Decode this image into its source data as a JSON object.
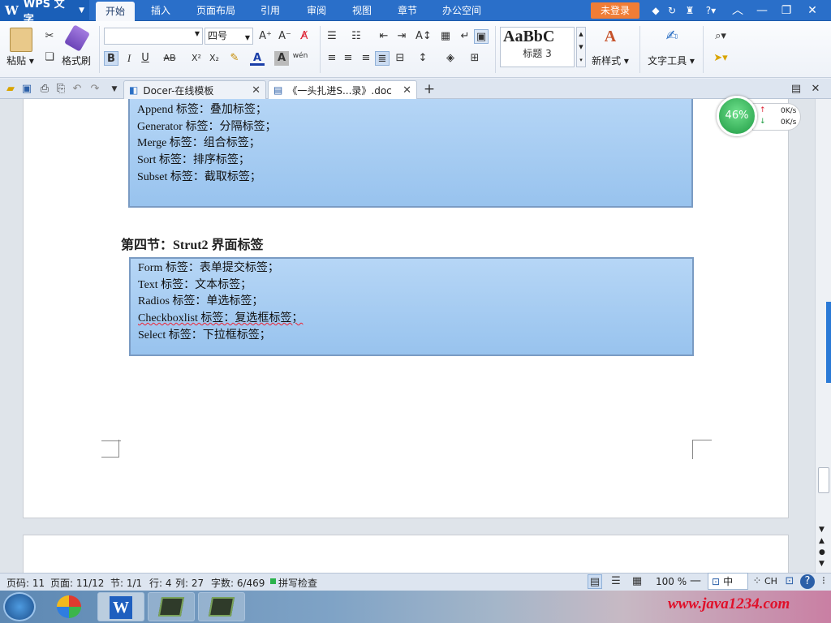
{
  "app": {
    "name": "WPS 文字",
    "logo_letter": "W"
  },
  "menu_tabs": [
    "开始",
    "插入",
    "页面布局",
    "引用",
    "审阅",
    "视图",
    "章节",
    "办公空间"
  ],
  "active_menu_tab": "开始",
  "login_button": "未登录",
  "ribbon": {
    "paste_label": "粘贴",
    "format_painter_label": "格式刷",
    "font_name_value": "",
    "font_size_value": "四号",
    "style_preview": "AaBbC",
    "style_name": "标题 3",
    "new_style_label": "新样式",
    "text_tools_label": "文字工具",
    "buttons": {
      "bold": "B",
      "italic": "I",
      "underline": "U",
      "strike": "AB",
      "superscript": "X²",
      "subscript": "X₂",
      "font_color": "A",
      "char_shade": "A",
      "phonetic": "wén"
    }
  },
  "doc_tabs": [
    {
      "label": "Docer-在线模板",
      "active": false
    },
    {
      "label": "《一头扎进S...录》.doc",
      "active": true
    }
  ],
  "document": {
    "box1_lines": [
      "Append 标签：叠加标签；",
      "Generator 标签：分隔标签；",
      "Merge 标签：组合标签；",
      "Sort 标签：排序标签；",
      "Subset 标签：截取标签；"
    ],
    "section_heading": "第四节：Strut2 界面标签",
    "box2_lines": [
      "Form 标签：表单提交标签；",
      "Text 标签：文本标签；",
      "Radios 标签：单选标签；",
      "Checkboxlist 标签：复选框标签；",
      "Select 标签：下拉框标签；"
    ]
  },
  "net_monitor": {
    "percent": "46%",
    "up_speed": "0K/s",
    "down_speed": "0K/s"
  },
  "status_bar": {
    "page_code": "页码: 11",
    "page": "页面: 11/12",
    "section": "节: 1/1",
    "row": "行: 4",
    "col": "列: 27",
    "word_count": "字数: 6/469",
    "spell_check": "拼写检查",
    "zoom": "100 %",
    "ime_lang": "中",
    "ime_ch": "CH"
  },
  "watermark": "www.java1234.com",
  "colors": {
    "titlebar": "#2a6fc9",
    "login": "#f07d36",
    "box_fill": "#a9cdf2",
    "box_border": "#7a9bc3"
  }
}
